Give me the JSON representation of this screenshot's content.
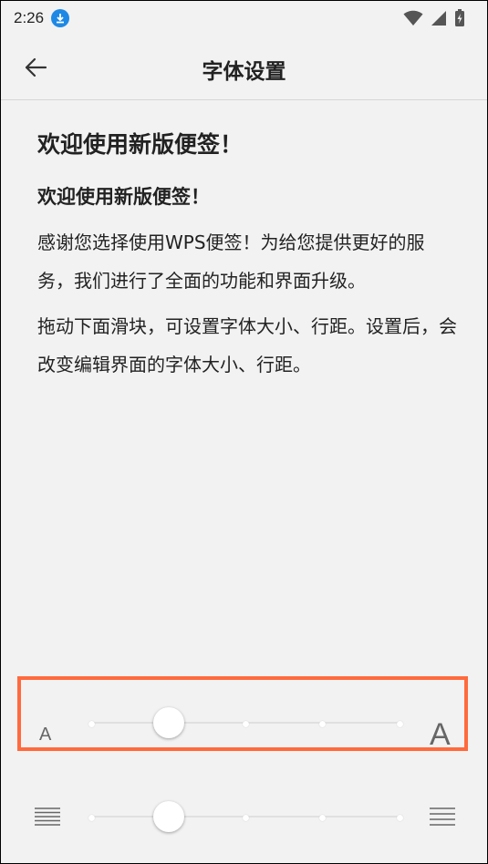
{
  "status_bar": {
    "time": "2:26"
  },
  "header": {
    "title": "字体设置"
  },
  "content": {
    "heading1": "欢迎使用新版便签！",
    "heading2": "欢迎使用新版便签！",
    "para1": "感谢您选择使用WPS便签！为给您提供更好的服务，我们进行了全面的功能和界面升级。",
    "para2": "拖动下面滑块，可设置字体大小、行距。设置后，会改变编辑界面的字体大小、行距。"
  },
  "font_size_slider": {
    "small_label": "A",
    "large_label": "A",
    "steps": 5,
    "selected_step": 1
  },
  "line_spacing_slider": {
    "steps": 5,
    "selected_step": 1
  },
  "colors": {
    "accent_highlight": "#ff6a3d",
    "download_badge": "#1e88e5"
  }
}
